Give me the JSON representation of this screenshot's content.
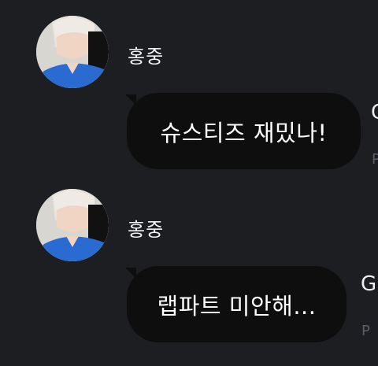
{
  "messages": [
    {
      "sender": "홍중",
      "text": "슈스티즈 재밌나!",
      "right_cut_text": "G",
      "right_cut_meta": "P"
    },
    {
      "sender": "홍중",
      "text": "랩파트 미안해...",
      "right_cut_text": "G",
      "right_cut_meta": "P"
    }
  ],
  "colors": {
    "background": "#1d1e21",
    "bubble": "#0e0e0f",
    "text": "#ffffff",
    "meta": "#5b5d6d"
  }
}
